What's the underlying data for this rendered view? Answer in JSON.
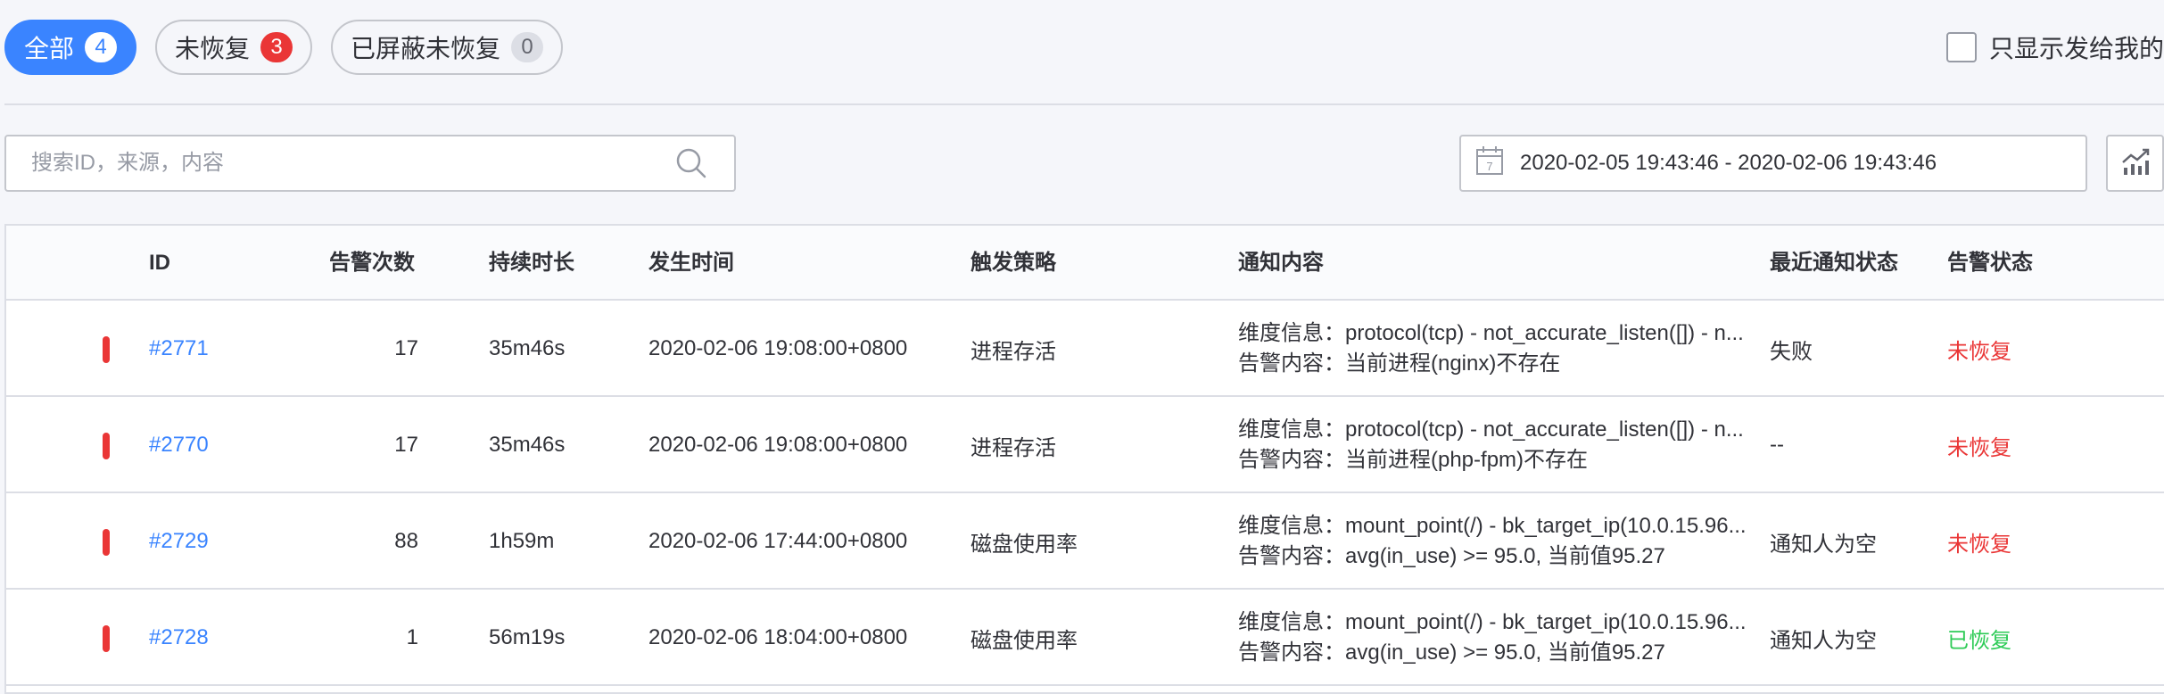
{
  "tabs": [
    {
      "label": "全部",
      "count": "4"
    },
    {
      "label": "未恢复",
      "count": "3"
    },
    {
      "label": "已屏蔽未恢复",
      "count": "0"
    }
  ],
  "only_mine_label": "只显示发给我的",
  "search": {
    "placeholder": "搜索ID，来源，内容"
  },
  "date_range": {
    "value": "2020-02-05 19:43:46 - 2020-02-06 19:43:46",
    "calendar_day": "7"
  },
  "table": {
    "headers": {
      "id": "ID",
      "count": "告警次数",
      "duration": "持续时长",
      "time": "发生时间",
      "strategy": "触发策略",
      "notice": "通知内容",
      "notify_status": "最近通知状态",
      "alarm_status": "告警状态"
    },
    "rows": [
      {
        "id": "#2771",
        "count": "17",
        "duration": "35m46s",
        "time": "2020-02-06 19:08:00+0800",
        "strategy": "进程存活",
        "dimension": "维度信息：protocol(tcp) - not_accurate_listen([]) - n...",
        "content": "告警内容：当前进程(nginx)不存在",
        "notify_status": "失败",
        "alarm_status": "未恢复",
        "alarm_color": "#ea3636",
        "level_color": "#ea3636"
      },
      {
        "id": "#2770",
        "count": "17",
        "duration": "35m46s",
        "time": "2020-02-06 19:08:00+0800",
        "strategy": "进程存活",
        "dimension": "维度信息：protocol(tcp) - not_accurate_listen([]) - n...",
        "content": "告警内容：当前进程(php-fpm)不存在",
        "notify_status": "--",
        "alarm_status": "未恢复",
        "alarm_color": "#ea3636",
        "level_color": "#ea3636"
      },
      {
        "id": "#2729",
        "count": "88",
        "duration": "1h59m",
        "time": "2020-02-06 17:44:00+0800",
        "strategy": "磁盘使用率",
        "dimension": "维度信息：mount_point(/) - bk_target_ip(10.0.15.96...",
        "content": "告警内容：avg(in_use) >= 95.0, 当前值95.27",
        "notify_status": "通知人为空",
        "alarm_status": "未恢复",
        "alarm_color": "#ea3636",
        "level_color": "#ea3636"
      },
      {
        "id": "#2728",
        "count": "1",
        "duration": "56m19s",
        "time": "2020-02-06 18:04:00+0800",
        "strategy": "磁盘使用率",
        "dimension": "维度信息：mount_point(/) - bk_target_ip(10.0.15.96...",
        "content": "告警内容：avg(in_use) >= 95.0, 当前值95.27",
        "notify_status": "通知人为空",
        "alarm_status": "已恢复",
        "alarm_color": "#2dcb56",
        "level_color": "#ea3636"
      }
    ]
  },
  "colors": {
    "primary": "#3a84ff",
    "danger": "#ea3636",
    "success": "#2dcb56"
  }
}
